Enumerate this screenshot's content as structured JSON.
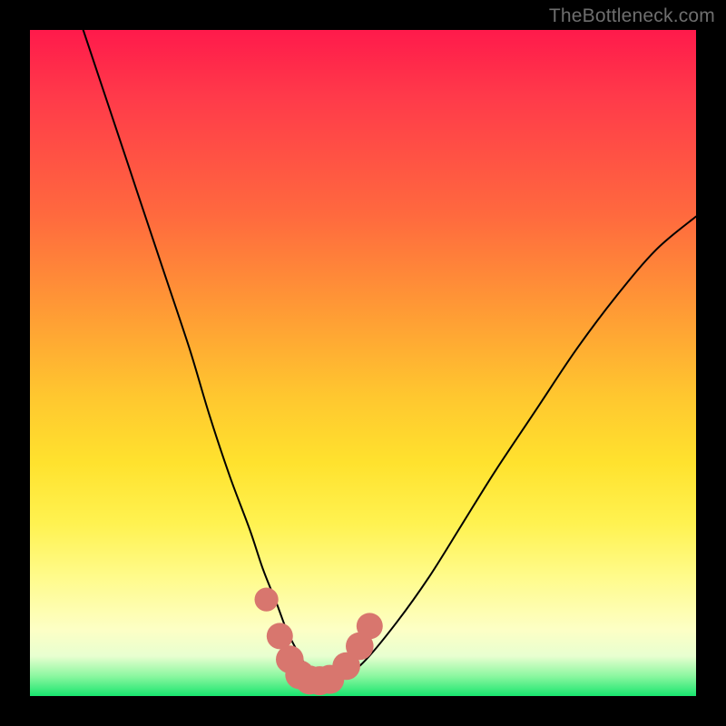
{
  "watermark": "TheBottleneck.com",
  "chart_data": {
    "type": "line",
    "title": "",
    "xlabel": "",
    "ylabel": "",
    "xlim": [
      0,
      100
    ],
    "ylim": [
      0,
      100
    ],
    "grid": false,
    "legend": false,
    "series": [
      {
        "name": "bottleneck-curve",
        "color": "#000000",
        "x": [
          8,
          12,
          16,
          20,
          24,
          27,
          30,
          33,
          35,
          37,
          38.5,
          40,
          41.5,
          43,
          45,
          47,
          50,
          55,
          60,
          65,
          70,
          76,
          82,
          88,
          94,
          100
        ],
        "y": [
          100,
          88,
          76,
          64,
          52,
          42,
          33,
          25,
          19,
          14,
          10,
          7,
          4.5,
          3,
          2.5,
          3,
          5,
          11,
          18,
          26,
          34,
          43,
          52,
          60,
          67,
          72
        ]
      }
    ],
    "markers": {
      "name": "highlight-dots",
      "color": "#d8766e",
      "points": [
        {
          "x": 35.5,
          "y": 14.5,
          "r": 1.1
        },
        {
          "x": 37.5,
          "y": 9.0,
          "r": 1.3
        },
        {
          "x": 39.0,
          "y": 5.5,
          "r": 1.4
        },
        {
          "x": 40.5,
          "y": 3.2,
          "r": 1.5
        },
        {
          "x": 42.0,
          "y": 2.4,
          "r": 1.5
        },
        {
          "x": 43.5,
          "y": 2.3,
          "r": 1.5
        },
        {
          "x": 45.0,
          "y": 2.5,
          "r": 1.5
        },
        {
          "x": 47.5,
          "y": 4.5,
          "r": 1.4
        },
        {
          "x": 49.5,
          "y": 7.5,
          "r": 1.4
        },
        {
          "x": 51.0,
          "y": 10.5,
          "r": 1.3
        }
      ]
    }
  }
}
